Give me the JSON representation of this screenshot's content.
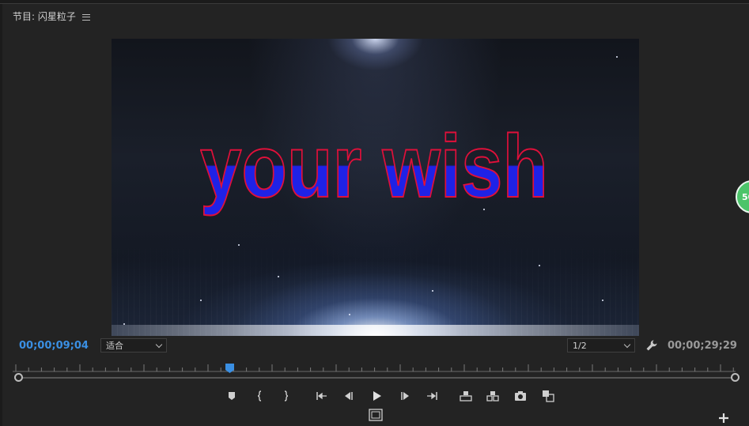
{
  "panel": {
    "title": "节目: 闪星粒子",
    "menu_icon": "hamburger-menu-icon"
  },
  "viewer": {
    "overlay_text": "your wish"
  },
  "timecode": {
    "current": "00;00;09;04",
    "duration": "00;00;29;29"
  },
  "fit_select": {
    "value": "适合"
  },
  "resolution_select": {
    "value": "1/2"
  },
  "playhead": {
    "position_fraction": 0.3
  },
  "controls": [
    {
      "name": "add-marker-button",
      "icon": "marker-icon"
    },
    {
      "name": "mark-in-button",
      "icon": "mark-in-icon"
    },
    {
      "name": "mark-out-button",
      "icon": "mark-out-icon"
    },
    {
      "name": "go-to-in-button",
      "icon": "go-to-in-icon"
    },
    {
      "name": "step-back-button",
      "icon": "step-back-icon"
    },
    {
      "name": "play-button",
      "icon": "play-icon"
    },
    {
      "name": "step-forward-button",
      "icon": "step-forward-icon"
    },
    {
      "name": "go-to-out-button",
      "icon": "go-to-out-icon"
    },
    {
      "name": "lift-button",
      "icon": "lift-icon"
    },
    {
      "name": "extract-button",
      "icon": "extract-icon"
    },
    {
      "name": "export-frame-button",
      "icon": "camera-icon"
    },
    {
      "name": "comparison-view-button",
      "icon": "compare-icon"
    }
  ],
  "badge": {
    "text": "50"
  },
  "colors": {
    "timecode_active": "#3a8fe3",
    "text_fill": "#1f22e6",
    "text_stroke": "#e0103a",
    "badge": "#4cc46a"
  }
}
